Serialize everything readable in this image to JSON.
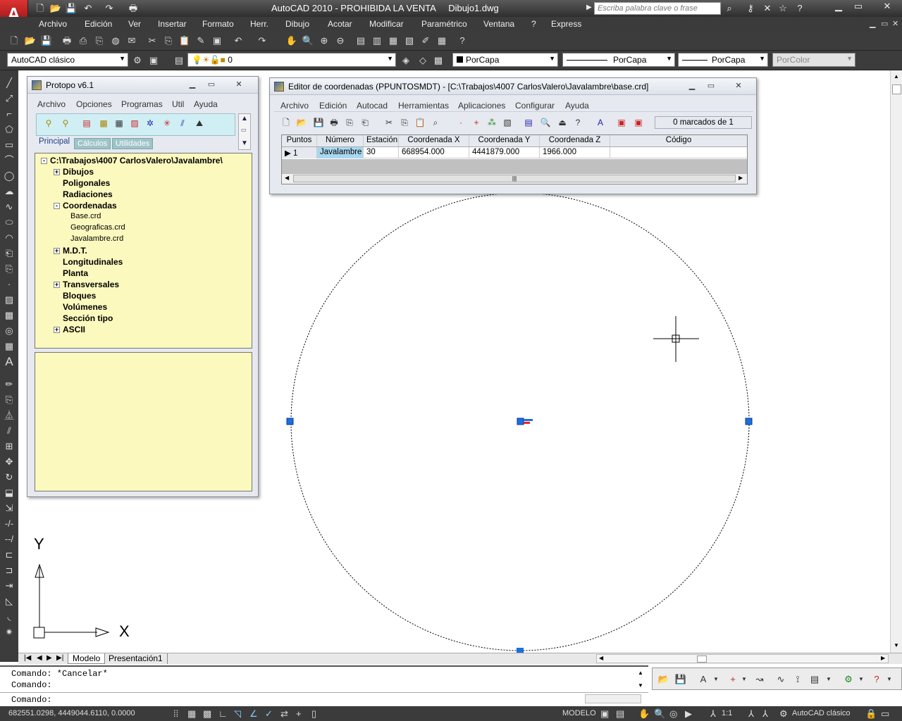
{
  "title": "AutoCAD 2010 - PROHIBIDA LA VENTA     Dibujo1.dwg",
  "search_placeholder": "Escriba palabra clave o frase",
  "menu": [
    "Archivo",
    "Edición",
    "Ver",
    "Insertar",
    "Formato",
    "Herr.",
    "Dibujo",
    "Acotar",
    "Modificar",
    "Paramétrico",
    "Ventana",
    "?",
    "Express"
  ],
  "toolbar2": {
    "workspace": "AutoCAD clásico",
    "layer": "0",
    "color": "PorCapa",
    "linetype": "PorCapa",
    "lineweight": "PorCapa",
    "plotstyle": "PorColor"
  },
  "protopo": {
    "title": "Protopo v6.1",
    "menu": [
      "Archivo",
      "Opciones",
      "Programas",
      "Util",
      "Ayuda"
    ],
    "tabs": [
      "Principal",
      "Cálculos",
      "Utilidades"
    ],
    "root": "C:\\Trabajos\\4007 CarlosValero\\Javalambre\\",
    "tree": [
      {
        "label": "Dibujos",
        "exp": "+"
      },
      {
        "label": "Poligonales",
        "exp": ""
      },
      {
        "label": "Radiaciones",
        "exp": ""
      },
      {
        "label": "Coordenadas",
        "exp": "-"
      },
      {
        "label": "Base.crd",
        "child": true
      },
      {
        "label": "Geograficas.crd",
        "child": true
      },
      {
        "label": "Javalambre.crd",
        "child": true
      },
      {
        "label": "M.D.T.",
        "exp": "+"
      },
      {
        "label": "Longitudinales",
        "exp": ""
      },
      {
        "label": "Planta",
        "exp": ""
      },
      {
        "label": "Transversales",
        "exp": "+"
      },
      {
        "label": "Bloques",
        "exp": ""
      },
      {
        "label": "Volúmenes",
        "exp": ""
      },
      {
        "label": "Sección tipo",
        "exp": ""
      },
      {
        "label": "ASCII",
        "exp": "+"
      }
    ]
  },
  "editor": {
    "title": "Editor de coordenadas (PPUNTOSMDT) - [C:\\Trabajos\\4007 CarlosValero\\Javalambre\\base.crd]",
    "menu": [
      "Archivo",
      "Edición",
      "Autocad",
      "Herramientas",
      "Aplicaciones",
      "Configurar",
      "Ayuda"
    ],
    "marked": "0 marcados de 1",
    "columns": [
      "Puntos",
      "Número",
      "Estación",
      "Coordenada X",
      "Coordenada Y",
      "Coordenada Z",
      "Código"
    ],
    "rows": [
      [
        "1",
        "Javalambre",
        "30",
        "668954.000",
        "4441879.000",
        "1966.000",
        ""
      ]
    ]
  },
  "tabs": [
    "Modelo",
    "Presentación1"
  ],
  "command": {
    "line1": "Comando: *Cancelar*",
    "line2": "Comando:",
    "prompt": "Comando:"
  },
  "ucs": {
    "x": "X",
    "y": "Y"
  },
  "status": {
    "coords": "682551.0298, 4449044.6110, 0.0000",
    "modelo": "MODELO",
    "scale": "1:1",
    "workspace": "AutoCAD clásico"
  }
}
